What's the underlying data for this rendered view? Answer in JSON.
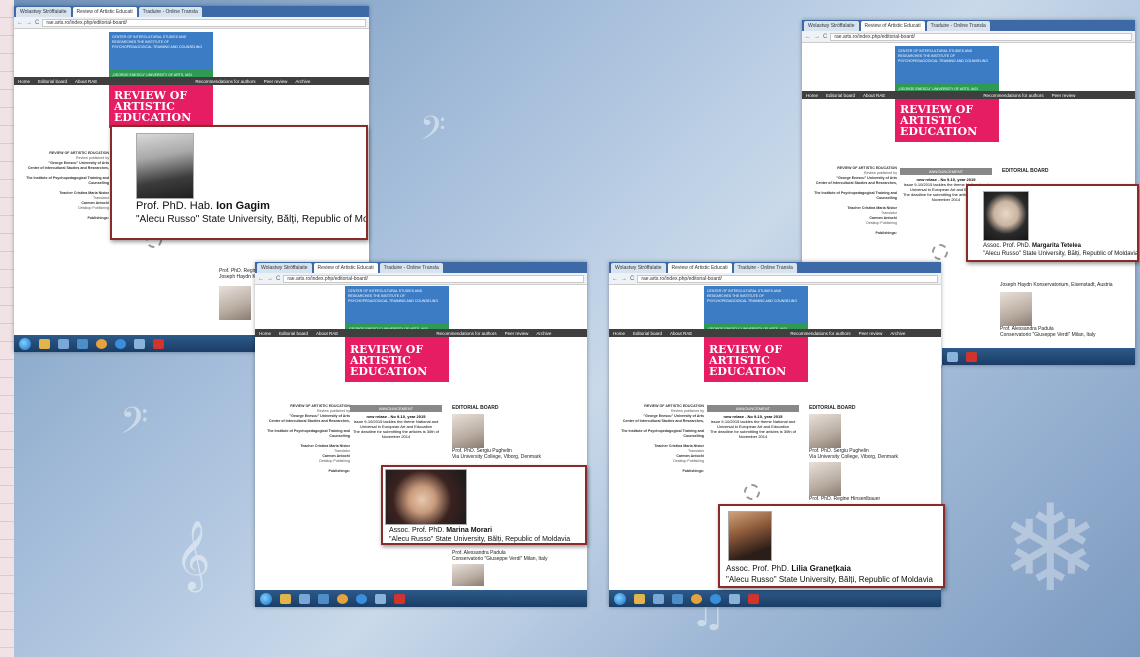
{
  "browser": {
    "tabs": [
      "Wolastwy Ströffalaite",
      "Review of Artistic Educati",
      "Traduire - Online Transla"
    ],
    "url": "rae.arts.ro/index.php/editorial-board/"
  },
  "site": {
    "header_block1": "CENTER OF INTERCULTURAL STUDIES AND RESEARCHES  THE INSTITUTE OF PSYCHOPEDAGOGICAL TRAINING AND COUNSELING",
    "header_block2": "„GEORGE ENESCU\" UNIVERSITY OF ARTS, IAȘI",
    "title": "REVIEW OF ARTISTIC EDUCATION",
    "nav": [
      "Home",
      "Editorial board",
      "About RAE",
      "Recommendations for authors",
      "Peer review",
      "Archive"
    ],
    "sidebar_heading": "REVIEW OF ARTISTIC EDUCATION",
    "sidebar_lines": [
      "Review published by",
      "\"George Enescu\" University of Arts",
      "Center of Intercultural Studies and Researches,",
      "The Institute of Psychopedagogical Training and Counselling",
      "Teacher Cristina Maria Nistor",
      "Translator",
      "Carmen Antochi",
      "Desktop Publishing",
      "Publishings:"
    ],
    "announcement_header": "ANNOUNCEMENT",
    "announcement_title": "new relase - No 9-10, year 2015",
    "announcement_text": "Issue 9-10/2015 tackles the theme National and Universal in European Art and Education",
    "deadline": "The deadline for submitting the articles is 30th of November 2014",
    "editorial_board": "EDITORIAL BOARD"
  },
  "people": {
    "p1": {
      "name": "Prof. PhD. Sergiu Pughelin",
      "inst": "Via University College, Viborg, Denmark"
    },
    "p2": {
      "name": "Prof. PhD. Regine Hinsenlbauer",
      "inst": "Joseph Haydn Konservatorium, Eisenstadt, Austria"
    },
    "p3": {
      "name": "Prof. Alessandra Padula",
      "inst": "Conservatorio \"Giuseppe Verdi\" Milan, Italy"
    }
  },
  "callouts": {
    "c1": {
      "prefix": "Prof. PhD. Hab.",
      "name": "Ion Gagim",
      "institution": "\"Alecu Russo\" State University, Bălți, Republic of Moldavia"
    },
    "c2": {
      "prefix": "Assoc. Prof. PhD.",
      "name": "Margarita Tetelea",
      "institution": "\"Alecu Russo\" State University, Bălți, Republic of Moldavia"
    },
    "c3": {
      "prefix": "Assoc. Prof. PhD.",
      "name": "Marina Morari",
      "institution": "\"Alecu Russo\" State University, Bălți, Republic of Moldavia"
    },
    "c4": {
      "prefix": "Assoc. Prof. PhD.",
      "name": "Lilia Granețkaia",
      "institution": "\"Alecu Russo\" State University, Bălți, Republic of Moldavia"
    }
  },
  "colors": {
    "header_blue": "#3b7cc5",
    "header_green": "#2e9a53",
    "title_pink": "#e61d63",
    "callout_border": "#8a2a2a"
  }
}
